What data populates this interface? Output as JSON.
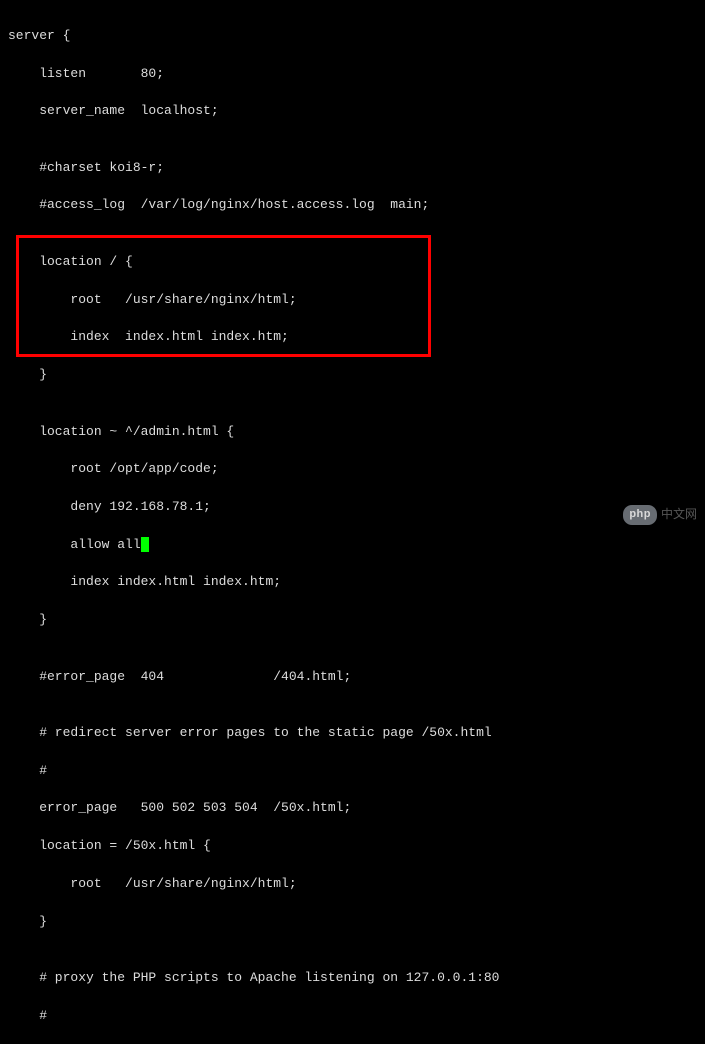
{
  "code": {
    "l1": "server {",
    "l2": "    listen       80;",
    "l3": "    server_name  localhost;",
    "l4": "",
    "l5": "    #charset koi8-r;",
    "l6": "    #access_log  /var/log/nginx/host.access.log  main;",
    "l7": "",
    "l8": "    location / {",
    "l9": "        root   /usr/share/nginx/html;",
    "l10": "        index  index.html index.htm;",
    "l11": "    }",
    "l12": "",
    "l13": "    location ~ ^/admin.html {",
    "l14": "        root /opt/app/code;",
    "l15": "        deny 192.168.78.1;",
    "l16a": "        allow all",
    "l16b": ";",
    "l17": "        index index.html index.htm;",
    "l18": "    }",
    "l19": "",
    "l20": "    #error_page  404              /404.html;",
    "l21": "",
    "l22": "    # redirect server error pages to the static page /50x.html",
    "l23": "    #",
    "l24": "    error_page   500 502 503 504  /50x.html;",
    "l25": "    location = /50x.html {",
    "l26": "        root   /usr/share/nginx/html;",
    "l27": "    }",
    "l28": "",
    "l29": "    # proxy the PHP scripts to Apache listening on 127.0.0.1:80",
    "l30": "    #"
  },
  "watermark": {
    "badge": "php",
    "text": "中文网"
  }
}
